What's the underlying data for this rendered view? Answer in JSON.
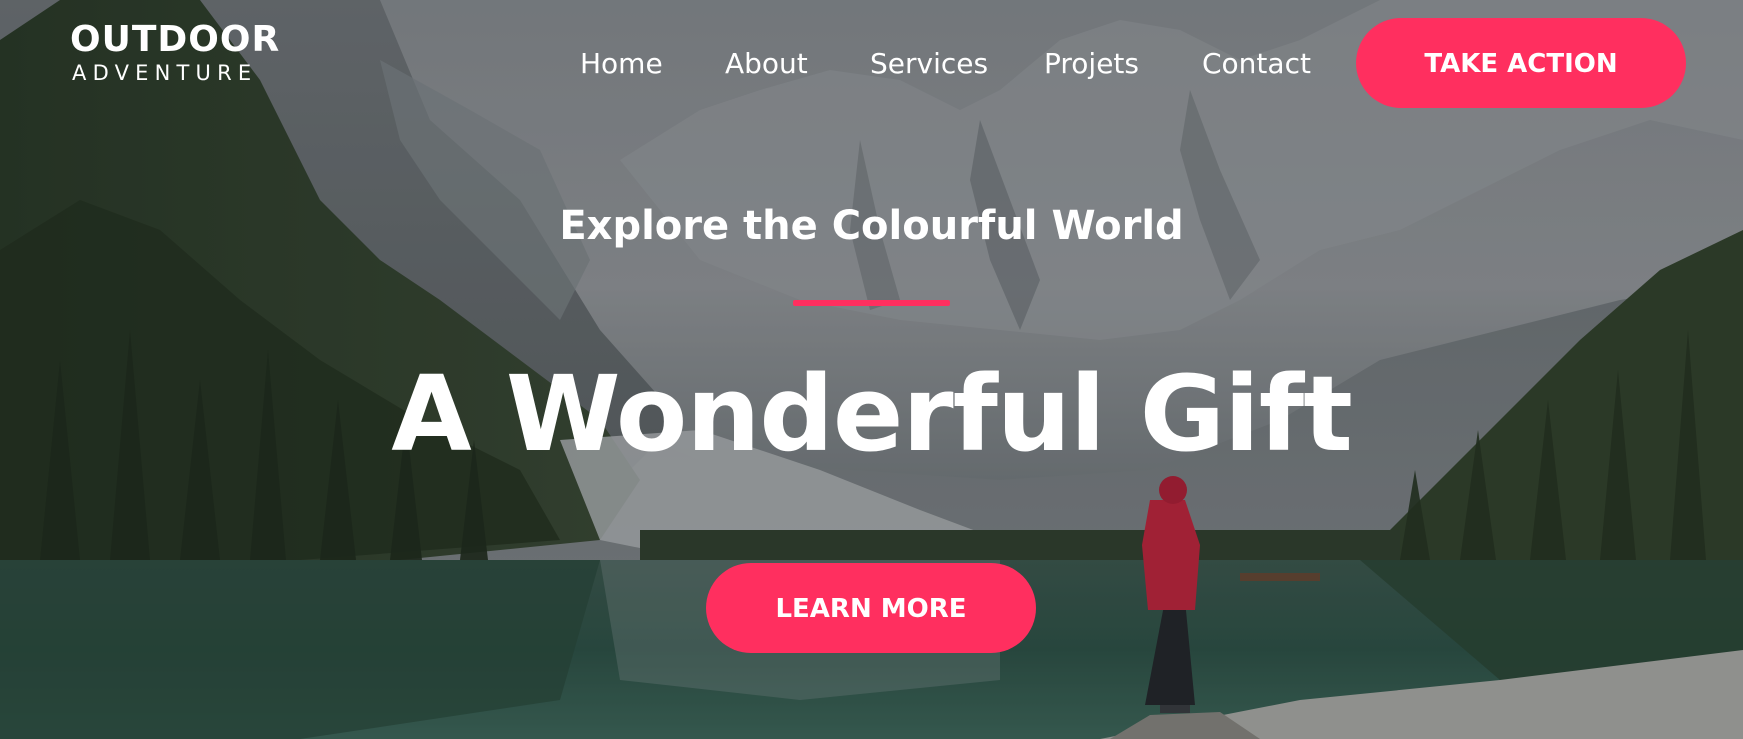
{
  "logo": {
    "line1": "OUTDOOR",
    "line2": "ADVENTURE"
  },
  "nav": {
    "items": [
      {
        "label": "Home"
      },
      {
        "label": "About"
      },
      {
        "label": "Services"
      },
      {
        "label": "Projets"
      },
      {
        "label": "Contact"
      }
    ],
    "cta_label": "TAKE ACTION"
  },
  "hero": {
    "subtitle": "Explore the Colourful World",
    "headline": "A Wonderful Gift",
    "button_label": "LEARN MORE",
    "background_scene": "mountain-lake-photo"
  },
  "colors": {
    "accent": "#ff2f5f",
    "text": "#ffffff"
  }
}
